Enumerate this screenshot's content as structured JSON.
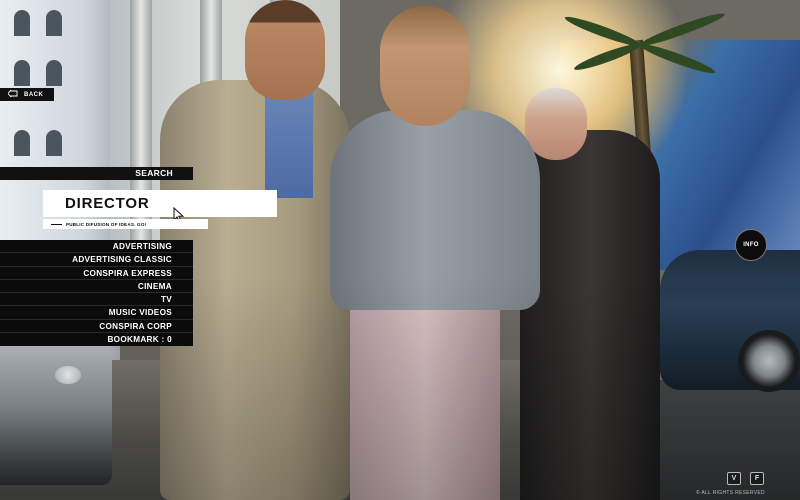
{
  "nav": {
    "back_label": "BACK"
  },
  "search": {
    "label": "SEARCH"
  },
  "section": {
    "title": "DIRECTOR",
    "tagline": "PUBLIC DIFUSION OF IDEAS. GO!"
  },
  "menu": {
    "items": [
      {
        "label": "ADVERTISING"
      },
      {
        "label": "ADVERTISING CLASSIC"
      },
      {
        "label": "CONSPIRA EXPRESS"
      },
      {
        "label": "CINEMA"
      },
      {
        "label": "TV"
      },
      {
        "label": "MUSIC VIDEOS"
      },
      {
        "label": "CONSPIRA CORP"
      },
      {
        "label": "BOOKMARK : 0"
      }
    ]
  },
  "info": {
    "label": "INFO"
  },
  "social": {
    "first_label": "V",
    "second_label": "F"
  },
  "footer": {
    "copyright": "© ALL RIGHTS RESERVED"
  },
  "colors": {
    "overlay_bg": "#0b0b0b",
    "overlay_text": "#ffffff",
    "highlight_bg": "#ffffff"
  },
  "icons": {
    "back": "back-arrow-icon",
    "cursor": "mouse-cursor-icon",
    "info": "info-circle-icon"
  }
}
